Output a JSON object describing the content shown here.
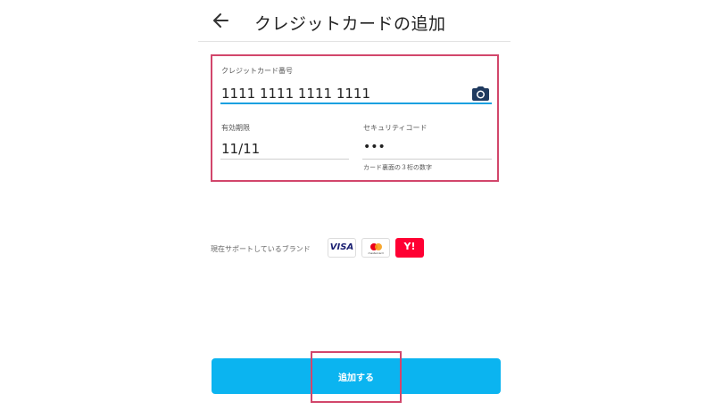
{
  "header": {
    "title": "クレジットカードの追加",
    "back_icon": "arrow-left-icon"
  },
  "form": {
    "card_number": {
      "label": "クレジットカード番号",
      "value": "1111 1111 1111 1111",
      "icon": "camera-icon"
    },
    "expiry": {
      "label": "有効期限",
      "value": "11/11"
    },
    "security_code": {
      "label": "セキュリティコード",
      "value": "•••",
      "helper": "カード裏面の３桁の数字"
    }
  },
  "brands": {
    "label": "現在サポートしているブランド",
    "items": [
      {
        "name": "visa",
        "text": "VISA"
      },
      {
        "name": "mastercard",
        "text": "mastercard"
      },
      {
        "name": "yahoo",
        "text": "Y!"
      }
    ]
  },
  "footer": {
    "add_button": "追加する"
  },
  "colors": {
    "accent": "#0bb4f0",
    "field_active": "#1aa0e0",
    "highlight": "#d2466b",
    "icon": "#1f3a5f"
  }
}
